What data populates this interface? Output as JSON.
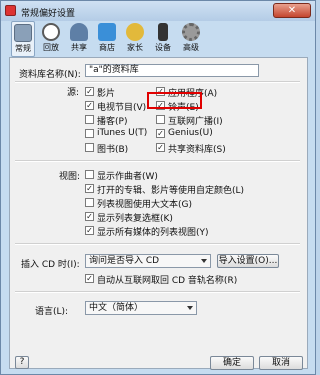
{
  "window": {
    "title": "常规偏好设置",
    "close_glyph": "✕"
  },
  "toolbar": [
    {
      "label": "常规",
      "icon": "toggle-switch-icon",
      "color": "#8aa0b8",
      "selected": true
    },
    {
      "label": "回放",
      "icon": "play-icon",
      "color": "#5a5a5a",
      "selected": false
    },
    {
      "label": "共享",
      "icon": "share-people-icon",
      "color": "#5e7fa6",
      "selected": false
    },
    {
      "label": "商店",
      "icon": "store-bag-icon",
      "color": "#3a8fd8",
      "selected": false
    },
    {
      "label": "家长",
      "icon": "parental-icon",
      "color": "#e2b93b",
      "selected": false
    },
    {
      "label": "设备",
      "icon": "device-icon",
      "color": "#333333",
      "selected": false
    },
    {
      "label": "高级",
      "icon": "advanced-gear-icon",
      "color": "#9a9a9a",
      "selected": false
    }
  ],
  "library": {
    "label": "资料库名称(N):",
    "value": "\"a\"的资料库"
  },
  "sources": {
    "label": "源:",
    "items": [
      {
        "label": "影片",
        "checked": true
      },
      {
        "label": "应用程序(A)",
        "checked": true
      },
      {
        "label": "电视节目(V)",
        "checked": true
      },
      {
        "label": "铃声(E)",
        "checked": true
      },
      {
        "label": "播客(P)",
        "checked": false
      },
      {
        "label": "互联网广播(I)",
        "checked": false
      },
      {
        "label": "iTunes U(T)",
        "checked": false
      },
      {
        "label": "Genius(U)",
        "checked": true
      },
      {
        "label": "图书(B)",
        "checked": false
      },
      {
        "label": "共享资料库(S)",
        "checked": true
      }
    ]
  },
  "views": {
    "label": "视图:",
    "items": [
      {
        "label": "显示作曲者(W)",
        "checked": false
      },
      {
        "label": "打开的专辑、影片等使用自定颜色(L)",
        "checked": true
      },
      {
        "label": "列表视图使用大文本(G)",
        "checked": false
      },
      {
        "label": "显示列表复选框(K)",
        "checked": true
      },
      {
        "label": "显示所有媒体的列表视图(Y)",
        "checked": true
      }
    ]
  },
  "cd": {
    "label": "插入 CD 时(I):",
    "select_value": "询问是否导入 CD",
    "import_button": "导入设置(O)...",
    "auto_label": "自动从互联网取回 CD 音轨名称(R)",
    "auto_checked": true
  },
  "language": {
    "label": "语言(L):",
    "value": "中文（简体）"
  },
  "footer": {
    "help": "?",
    "ok": "确定",
    "cancel": "取消"
  },
  "colors": {
    "highlight": "#e00000",
    "check": "✓"
  }
}
